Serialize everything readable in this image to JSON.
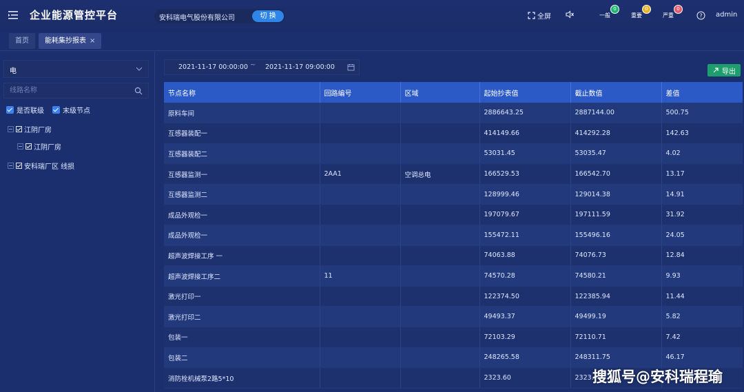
{
  "header": {
    "title": "企业能源管控平台",
    "company": "安科瑞电气股份有限公司",
    "switch_label": "切 换",
    "fullscreen_label": "全屏",
    "alarms": [
      {
        "label": "一般",
        "count": "0",
        "color": "#1fb871"
      },
      {
        "label": "重要",
        "count": "0",
        "color": "#e8b62c"
      },
      {
        "label": "严重",
        "count": "0",
        "color": "#e45c6b"
      }
    ],
    "user": "admin"
  },
  "tabs": [
    {
      "label": "首页",
      "active": false
    },
    {
      "label": "能耗集抄报表",
      "active": true,
      "close": "×"
    }
  ],
  "left": {
    "energy_select": "电",
    "search_placeholder": "线路名称",
    "check_cascade": "是否联级",
    "check_leaf": "末级节点",
    "tree": [
      {
        "label": "江阴厂房",
        "level": 0
      },
      {
        "label": "江阴厂房",
        "level": 1
      },
      {
        "label": "安科瑞厂区 线损",
        "level": 0
      }
    ]
  },
  "toolbar": {
    "date_start": "2021-11-17 00:00:00",
    "date_sep": "~",
    "date_end": "2021-11-17 09:00:00",
    "export_label": "导出"
  },
  "table": {
    "columns": [
      "节点名称",
      "回路编号",
      "区域",
      "起始抄表值",
      "截止数值",
      "差值"
    ],
    "rows": [
      [
        "原料车间",
        "",
        "",
        "2886643.25",
        "2887144.00",
        "500.75"
      ],
      [
        "互感器装配一",
        "",
        "",
        "414149.66",
        "414292.28",
        "142.63"
      ],
      [
        "互感器装配二",
        "",
        "",
        "53031.45",
        "53035.47",
        "4.02"
      ],
      [
        "互感器监测一",
        "2AA1",
        "空调总电",
        "166529.53",
        "166542.70",
        "13.17"
      ],
      [
        "互感器监测二",
        "",
        "",
        "128999.46",
        "129014.38",
        "14.91"
      ],
      [
        "成品外观检一",
        "",
        "",
        "197079.67",
        "197111.59",
        "31.92"
      ],
      [
        "成品外观检一",
        "",
        "",
        "155472.11",
        "155496.16",
        "24.05"
      ],
      [
        "超声波焊接工序 一",
        "",
        "",
        "74063.88",
        "74076.73",
        "12.84"
      ],
      [
        "超声波焊接工序二",
        "11",
        "",
        "74570.28",
        "74580.21",
        "9.93"
      ],
      [
        "激光打印一",
        "",
        "",
        "122374.50",
        "122385.94",
        "11.44"
      ],
      [
        "激光打印二",
        "",
        "",
        "49493.37",
        "49499.19",
        "5.82"
      ],
      [
        "包装一",
        "",
        "",
        "72103.29",
        "72110.71",
        "7.42"
      ],
      [
        "包装二",
        "",
        "",
        "248265.58",
        "248311.75",
        "46.17"
      ],
      [
        "消防栓机械泵2路5*10",
        "",
        "",
        "2323.60",
        "2323.",
        ""
      ]
    ]
  },
  "watermark": "搜狐号@安科瑞程瑜"
}
